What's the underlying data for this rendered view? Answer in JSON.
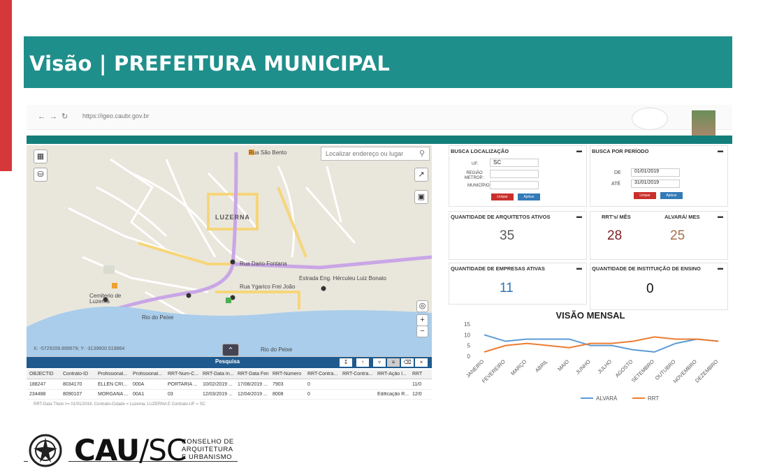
{
  "header": {
    "title": "Visão | PREFEITURA MUNICIPAL"
  },
  "browser": {
    "url": "https://igeo.caubr.gov.br"
  },
  "map": {
    "search_placeholder": "Localizar endereço ou lugar",
    "labels": {
      "luzerna": "LUZERNA",
      "rua_dario": "Rua Dario Fontana",
      "rua_ygarico": "Rua Ygarico Frei João",
      "estrada": "Estrada Eng. Hérculeu Luiz Bonato",
      "rio_peixe_1": "Rio do Peixe",
      "rio_peixe_2": "Rio do Peixe",
      "cemiterio": "Cemiterio de Luzerna",
      "rua_sao_bento": "Rua São Bento",
      "coords": "X: -5729209.899679; Y: -3139600.519864"
    }
  },
  "grid": {
    "title": "Pesquisa",
    "columns": [
      "OBJECTID",
      "Contrato-ID",
      "Profissional...",
      "Profissional...",
      "RRT-Num-C...",
      "RRT-Data In...",
      "RRT-Data Fim",
      "RRT-Número",
      "RRT-Contra...",
      "RRT-Contra...",
      "RRT-Ação I...",
      "RRT"
    ],
    "rows": [
      [
        "188247",
        "8034170",
        "ELLEN CRI...",
        "000A",
        "PORTARIA ...",
        "10/02/2019 ...",
        "17/08/2019 ...",
        "7903",
        "0",
        "",
        "",
        "11/0"
      ],
      [
        "234488",
        "8090107",
        "MORGANA ...",
        "00A1",
        "03",
        "12/03/2019 ...",
        "12/04/2019 ...",
        "8008",
        "0",
        "",
        "Edificação R...",
        "12/0"
      ]
    ],
    "filter_text": "RRT-Data Título >= 01/01/2019, Contrato-Cidade = Luzerna, LUZERNA E Contrato-UF = SC"
  },
  "busca_localizacao": {
    "title": "BUSCA LOCALIZAÇÃO",
    "uf_label": "UF:",
    "uf_value": "SC",
    "regiao_label": "REGIÃO METROP.:",
    "municipio_label": "MUNICÍPIO:",
    "btn_limpar": "Limpar",
    "btn_aplicar": "Aplicar"
  },
  "busca_periodo": {
    "title": "BUSCA POR PERÍODO",
    "de_label": "DE",
    "de_value": "01/01/2019",
    "ate_label": "ATÉ",
    "ate_value": "31/01/2019",
    "btn_limpar": "Limpar",
    "btn_aplicar": "Aplicar"
  },
  "kpis": {
    "arquitetos": {
      "label": "QUANTIDADE DE ARQUITETOS ATIVOS",
      "value": "35"
    },
    "rrt": {
      "label": "RRT's/ MÊS",
      "value": "28"
    },
    "alvara": {
      "label": "ALVARÁ/ MES",
      "value": "25"
    },
    "empresas": {
      "label": "QUANTIDADE DE EMPRESAS ATIVAS",
      "value": "11"
    },
    "instituicoes": {
      "label": "QUANTIDADE DE INSTITUIÇÃO DE ENSINO",
      "value": "0"
    }
  },
  "colors": {
    "teal": "#1f8f8b",
    "red_bar": "#d6373a",
    "alvara": "#5b9bd5",
    "rrt": "#ed7d31",
    "kpi_blue": "#2e75b6",
    "kpi_dark": "#595959",
    "kpi_maroon": "#7b1e24",
    "kpi_brown": "#a5704a"
  },
  "chart_data": {
    "type": "line",
    "title": "VISÃO MENSAL",
    "categories": [
      "JANEIRO",
      "FEVEREIRO",
      "MARÇO",
      "ABRIL",
      "MAIO",
      "JUNHO",
      "JULHO",
      "AGOSTO",
      "SETEMBRO",
      "OUTUBRO",
      "NOVEMBRO",
      "DEZEMBRO"
    ],
    "ylim": [
      0,
      15
    ],
    "yticks": [
      "0",
      "5",
      "10",
      "15"
    ],
    "series": [
      {
        "name": "ALVARÁ",
        "values": [
          10,
          7,
          8,
          8,
          8,
          5,
          5,
          3,
          2,
          6,
          8,
          7
        ]
      },
      {
        "name": "RRT",
        "values": [
          2,
          5,
          6,
          5,
          4,
          6,
          6,
          7,
          9,
          8,
          8,
          7
        ]
      }
    ],
    "legend": "bottom",
    "grid": false
  },
  "footer": {
    "cau": "CAU",
    "sc": "/SC",
    "conselho_lines": [
      "CONSELHO DE",
      "ARQUITETURA",
      "E URBANISMO"
    ]
  }
}
